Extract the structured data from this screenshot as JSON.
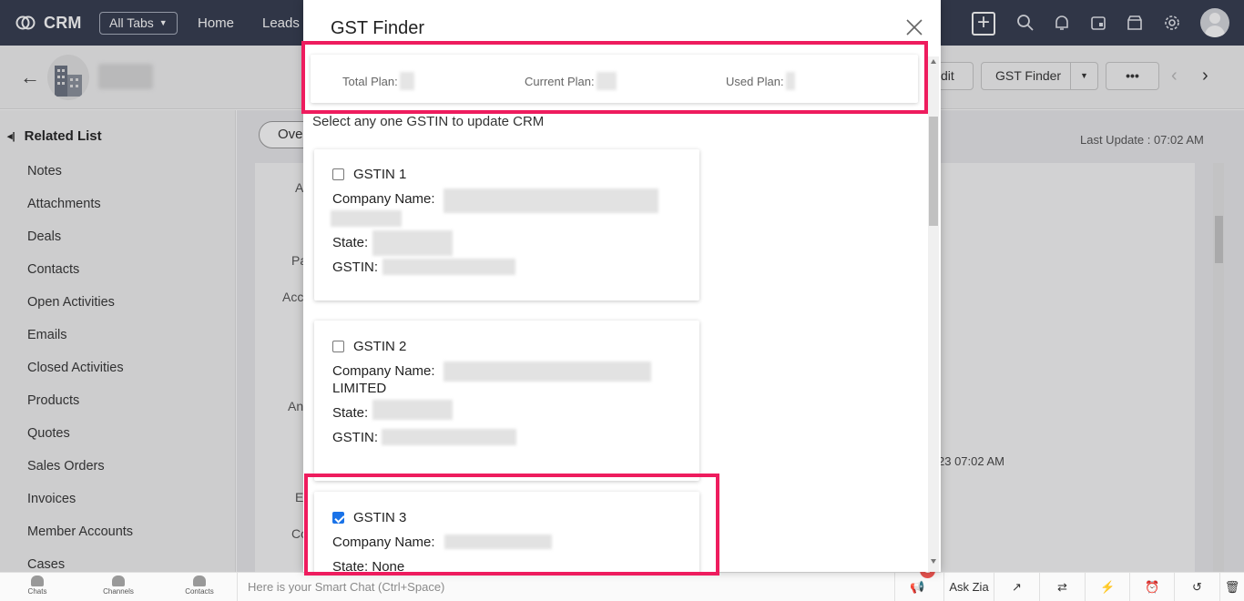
{
  "app": {
    "logo_text": "CRM",
    "all_tabs_label": "All Tabs",
    "nav": [
      "Home",
      "Leads"
    ]
  },
  "toolbar": {
    "edit_label": "dit",
    "gst_finder_label": "GST Finder",
    "more_label": "•••"
  },
  "sidebar": {
    "heading": "Related List",
    "items": [
      "Notes",
      "Attachments",
      "Deals",
      "Contacts",
      "Open Activities",
      "Emails",
      "Closed Activities",
      "Products",
      "Quotes",
      "Sales Orders",
      "Invoices",
      "Member Accounts",
      "Cases"
    ]
  },
  "main": {
    "overview_tab": "Ove",
    "last_update": "Last Update : 07:02 AM",
    "fragments": [
      "A",
      "Pa",
      "Acc",
      "An",
      "E",
      "Co"
    ],
    "timestamp": "23 07:02 AM"
  },
  "modal": {
    "title": "GST Finder",
    "plans": {
      "total_label": "Total Plan:",
      "current_label": "Current Plan:",
      "used_label": "Used Plan:"
    },
    "instruction": "Select any one GSTIN to update CRM",
    "gstins": [
      {
        "label": "GSTIN 1",
        "checked": false,
        "company_label": "Company Name:",
        "company_extra": "",
        "state_label": "State:",
        "gstin_label": "GSTIN:"
      },
      {
        "label": "GSTIN 2",
        "checked": false,
        "company_label": "Company Name:",
        "company_extra": "LIMITED",
        "state_label": "State:",
        "gstin_label": "GSTIN:"
      },
      {
        "label": "GSTIN 3",
        "checked": true,
        "company_label": "Company Name:",
        "state_label": "State: None"
      }
    ]
  },
  "bottombar": {
    "chats": "Chats",
    "channels": "Channels",
    "contacts": "Contacts",
    "smart_chat_placeholder": "Here is your Smart Chat (Ctrl+Space)",
    "notification_count": "1",
    "ask_zia": "Ask Zia"
  },
  "colors": {
    "topbar": "#323a4e",
    "highlight": "#ee1c5e",
    "checkbox_checked": "#1a73e8"
  }
}
